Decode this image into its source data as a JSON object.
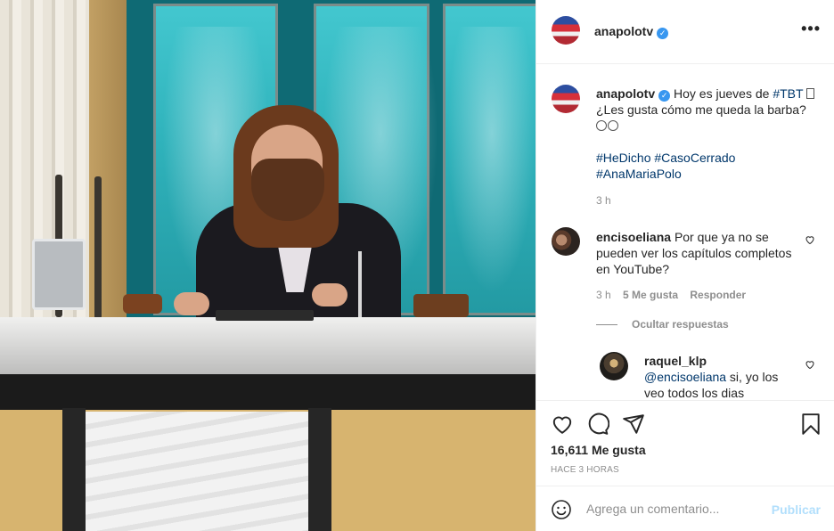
{
  "post": {
    "username": "anapolotv",
    "verified_mark": "✓",
    "more_glyph": "•••"
  },
  "caption": {
    "username": "anapolotv",
    "text_before_tag": "Hoy es jueves de ",
    "tag_tbt": "#TBT",
    "text_line2": "¿Les gusta cómo me queda la barba?",
    "hashtags": [
      "#HeDicho",
      "#CasoCerrado",
      "#AnaMariaPolo"
    ],
    "time": "3 h"
  },
  "comment": {
    "username": "encisoeliana",
    "text": "Por que ya no se pueden ver los capítulos completos en YouTube?",
    "time": "3 h",
    "likes": "5 Me gusta",
    "reply_label": "Responder",
    "hide_replies": "Ocultar respuestas"
  },
  "reply": {
    "username": "raquel_klp",
    "mention": "@encisoeliana",
    "text": " si, yo los veo todos los dias"
  },
  "actions": {
    "likes_count": "16,611 Me gusta",
    "posted_ago": "HACE 3 HORAS"
  },
  "add_comment": {
    "placeholder": "Agrega un comentario...",
    "publish_label": "Publicar"
  },
  "icons": [
    "more-options-icon",
    "verified-icon",
    "heart-icon",
    "comment-icon",
    "share-icon",
    "bookmark-icon",
    "emoji-icon"
  ],
  "colors": {
    "link": "#00376b",
    "verified": "#3897f0",
    "publish_disabled": "#b2dffc",
    "muted": "#8e8e8e"
  }
}
